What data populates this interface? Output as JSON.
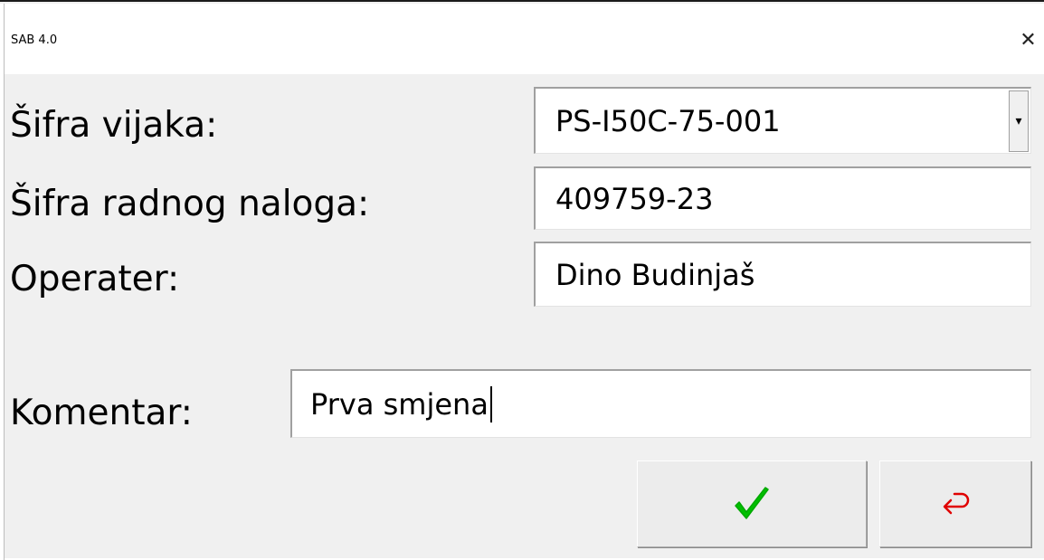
{
  "window": {
    "title": "SAB 4.0",
    "close_glyph": "✕"
  },
  "form": {
    "screw_code": {
      "label": "Šifra vijaka:",
      "value": "PS-I50C-75-001",
      "arrow_glyph": "▾"
    },
    "work_order": {
      "label": "Šifra radnog naloga:",
      "value": "409759-23"
    },
    "operator": {
      "label": "Operater:",
      "value": "Dino Budinjaš"
    },
    "comment": {
      "label": "Komentar:",
      "value": "Prva smjena"
    }
  },
  "buttons": {
    "confirm": {
      "icon": "checkmark-icon",
      "color": "#00c000"
    },
    "back": {
      "icon": "return-arrow-icon",
      "color": "#e00000"
    }
  }
}
